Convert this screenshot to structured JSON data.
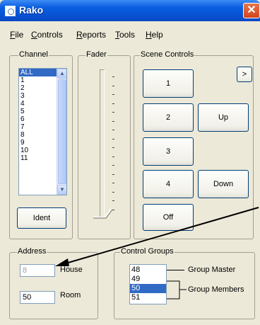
{
  "window": {
    "title": "Rako",
    "close_glyph": "✕"
  },
  "menu": [
    {
      "label": "File",
      "accel": "F",
      "rest": "ile"
    },
    {
      "label": "Controls",
      "accel": "C",
      "rest": "ontrols"
    },
    {
      "label": "Reports",
      "accel": "R",
      "rest": "eports"
    },
    {
      "label": "Tools",
      "accel": "T",
      "rest": "ools"
    },
    {
      "label": "Help",
      "accel": "H",
      "rest": "elp"
    }
  ],
  "channel": {
    "label": "Channel",
    "items": [
      "ALL",
      "1",
      "2",
      "3",
      "4",
      "5",
      "6",
      "7",
      "8",
      "9",
      "10",
      "11"
    ],
    "selected": "ALL",
    "ident_label": "Ident"
  },
  "fader": {
    "label": "Fader",
    "level": 0.0
  },
  "scene_controls": {
    "label": "Scene Controls",
    "scene_buttons": [
      "1",
      "2",
      "3",
      "4",
      "Off"
    ],
    "more_label": ">",
    "up_label": "Up",
    "down_label": "Down"
  },
  "address": {
    "label": "Address",
    "house_value": "8",
    "house_label": "House",
    "room_value": "50",
    "room_label": "Room"
  },
  "control_groups": {
    "label": "Control Groups",
    "items": [
      "48",
      "49",
      "50",
      "51"
    ],
    "selected": "50",
    "group_master_label": "Group Master",
    "group_members_label": "Group Members"
  },
  "colors": {
    "title_bar": "#0a5ee0",
    "selection": "#316ac5",
    "face": "#ece9d8",
    "close": "#d3441c"
  }
}
